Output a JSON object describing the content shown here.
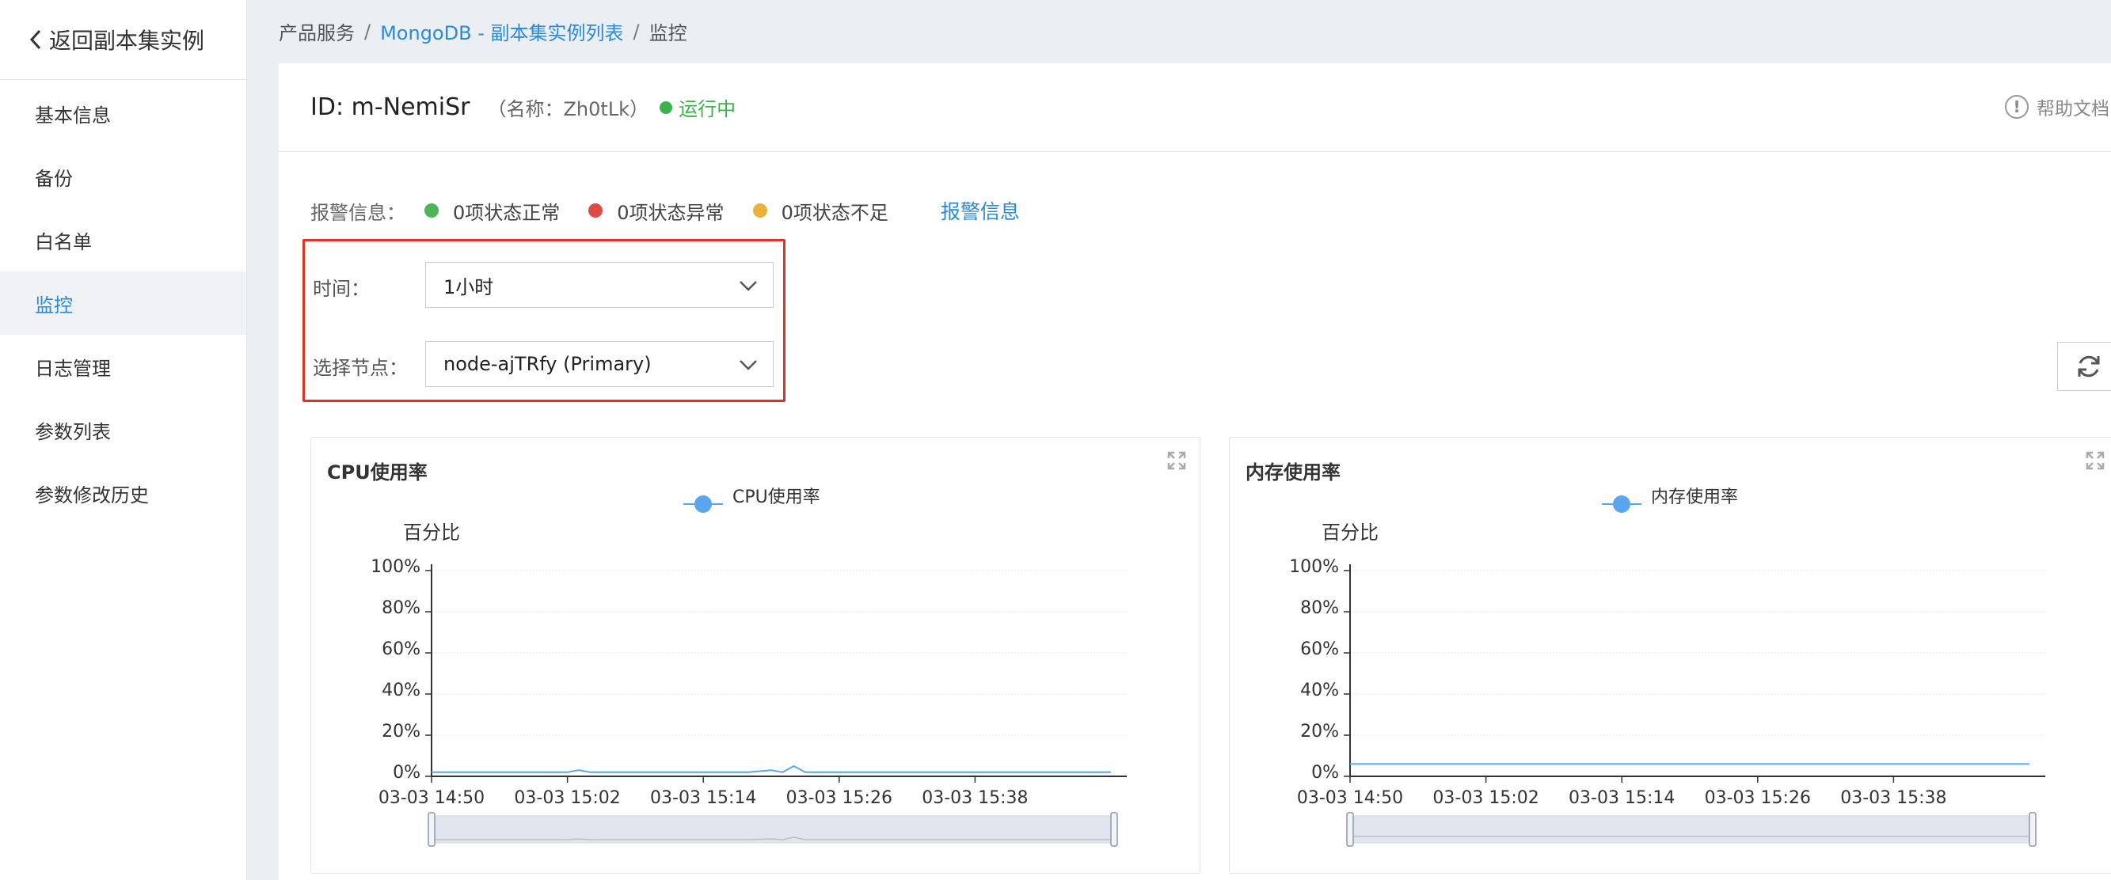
{
  "sidebar": {
    "back_label": "返回副本集实例",
    "items": [
      {
        "label": "基本信息"
      },
      {
        "label": "备份"
      },
      {
        "label": "白名单"
      },
      {
        "label": "监控"
      },
      {
        "label": "日志管理"
      },
      {
        "label": "参数列表"
      },
      {
        "label": "参数修改历史"
      }
    ],
    "active_index": 3
  },
  "breadcrumb": {
    "items": [
      "产品服务",
      "MongoDB - 副本集实例列表",
      "监控"
    ],
    "separator": "/"
  },
  "header": {
    "id_text": "ID: m-NemiSr",
    "name_text": "（名称：Zh0tLk）",
    "status_text": "运行中",
    "help_text": "帮助文档"
  },
  "alarm": {
    "label": "报警信息：",
    "items": [
      {
        "text": "0项状态正常",
        "color": "#4fb35a"
      },
      {
        "text": "0项状态异常",
        "color": "#de4a47"
      },
      {
        "text": "0项状态不足",
        "color": "#eab23a"
      }
    ],
    "link_text": "报警信息"
  },
  "filters": {
    "time_label": "时间：",
    "time_value": "1小时",
    "node_label": "选择节点：",
    "node_value": "node-ajTRfy (Primary)"
  },
  "colors": {
    "accent": "#2b8ad8",
    "running": "#3bb34a",
    "highlight_border": "#e0302b",
    "series_line": "#5aa6ee"
  },
  "chart_data": [
    {
      "type": "line",
      "title": "CPU使用率",
      "ylabel": "百分比",
      "ylim": [
        0,
        100
      ],
      "yticks": [
        "0%",
        "20%",
        "40%",
        "60%",
        "80%",
        "100%"
      ],
      "xticks": [
        "03-03 14:50",
        "03-03 15:02",
        "03-03 15:14",
        "03-03 15:26",
        "03-03 15:38"
      ],
      "legend_position": "top-center",
      "series": [
        {
          "name": "CPU使用率",
          "x": [
            "03-03 14:50",
            "03-03 14:56",
            "03-03 15:02",
            "03-03 15:03",
            "03-03 15:04",
            "03-03 15:10",
            "03-03 15:18",
            "03-03 15:20",
            "03-03 15:21",
            "03-03 15:22",
            "03-03 15:23",
            "03-03 15:24",
            "03-03 15:30",
            "03-03 15:40",
            "03-03 15:50"
          ],
          "values": [
            2,
            2,
            2,
            3,
            2,
            2,
            2,
            3,
            2,
            5,
            2,
            2,
            2,
            2,
            2
          ]
        }
      ]
    },
    {
      "type": "line",
      "title": "内存使用率",
      "ylabel": "百分比",
      "ylim": [
        0,
        100
      ],
      "yticks": [
        "0%",
        "20%",
        "40%",
        "60%",
        "80%",
        "100%"
      ],
      "xticks": [
        "03-03 14:50",
        "03-03 15:02",
        "03-03 15:14",
        "03-03 15:26",
        "03-03 15:38"
      ],
      "legend_position": "top-center",
      "series": [
        {
          "name": "内存使用率",
          "x": [
            "03-03 14:50",
            "03-03 15:50"
          ],
          "values": [
            6,
            6
          ]
        }
      ]
    }
  ]
}
